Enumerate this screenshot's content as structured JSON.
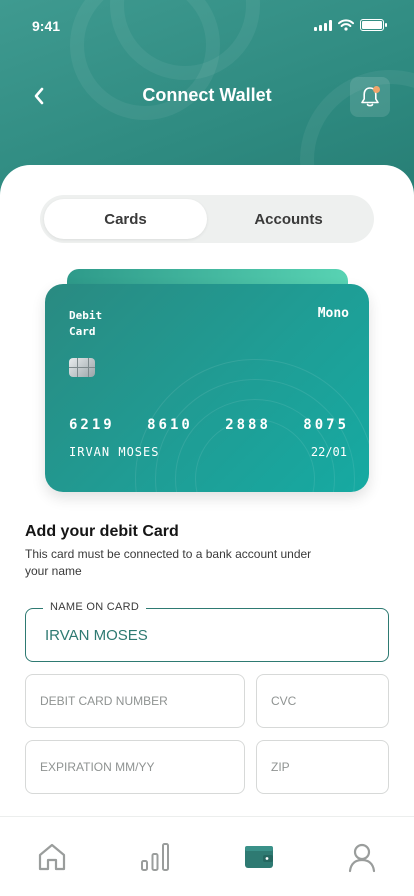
{
  "status_bar": {
    "time": "9:41"
  },
  "header": {
    "title": "Connect Wallet",
    "back_icon": "chevron-left-icon",
    "notification_icon": "bell-icon",
    "notification_dot_color": "#f0a56b"
  },
  "tabs": [
    {
      "label": "Cards",
      "active": true
    },
    {
      "label": "Accounts",
      "active": false
    }
  ],
  "card": {
    "type_label": "Debit Card",
    "brand": "Mono",
    "number_groups": [
      "6219",
      "8610",
      "2888",
      "8075"
    ],
    "holder": "IRVAN MOSES",
    "expiry": "22/01"
  },
  "form": {
    "heading": "Add your debit Card",
    "subheading": "This card must be connected to a bank account under your name",
    "name_label": "NAME ON CARD",
    "name_value": "IRVAN MOSES",
    "card_number_placeholder": "DEBIT CARD NUMBER",
    "cvc_placeholder": "CVC",
    "expiration_placeholder": "EXPIRATION MM/YY",
    "zip_placeholder": "ZIP"
  },
  "bottom_nav": [
    {
      "icon": "home-icon",
      "active": false
    },
    {
      "icon": "chart-icon",
      "active": false
    },
    {
      "icon": "wallet-icon",
      "active": true
    },
    {
      "icon": "profile-icon",
      "active": false
    }
  ],
  "colors": {
    "accent": "#2e7a72",
    "header": "#2e8a80",
    "inactive_icon": "#9a9d9c"
  }
}
